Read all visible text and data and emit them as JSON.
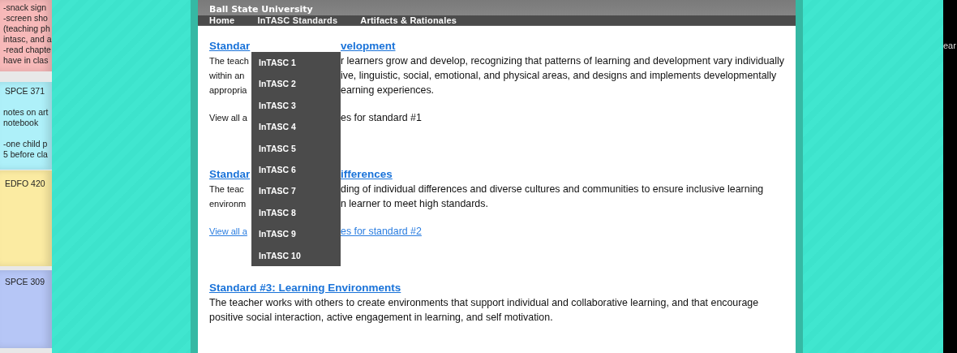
{
  "sticky_notes": [
    {
      "color": "#f7b9b9",
      "paragraphs": [
        [
          "-snack sign",
          "-screen sho",
          "(teaching ph",
          "intasc, and a",
          "-read chapte",
          "have in clas"
        ]
      ]
    },
    {
      "color": "#aef0f9",
      "title": "SPCE 371",
      "paragraphs": [
        [
          "notes on art",
          "notebook"
        ],
        [
          "-one child p",
          "5 before cla"
        ]
      ]
    },
    {
      "color": "#fbeba2",
      "title": "EDFO 420"
    },
    {
      "color": "#b6c6f6",
      "title": "SPCE 309"
    }
  ],
  "site": {
    "header_title": "Ball State University",
    "nav": [
      {
        "label": "Home"
      },
      {
        "label": "InTASC Standards",
        "expanded": true,
        "menu": [
          "InTASC 1",
          "InTASC 2",
          "InTASC 3",
          "InTASC 4",
          "InTASC 5",
          "InTASC 6",
          "InTASC 7",
          "InTASC 8",
          "InTASC 9",
          "InTASC 10"
        ]
      },
      {
        "label": "Artifacts & Rationales"
      }
    ],
    "sections": [
      {
        "title": [
          "Standar",
          "velopment"
        ],
        "text": [
          [
            "The teach",
            "r learners grow and develop, recognizing that patterns of learning and development vary individually"
          ],
          [
            "within an",
            "ive, linguistic, social, emotional, and physical areas, and designs and implements developmentally"
          ],
          [
            "appropria",
            "earning experiences."
          ]
        ],
        "view": {
          "link": false,
          "parts": [
            "View all a",
            "es for standard #1"
          ]
        }
      },
      {
        "title": [
          "Standar",
          "ifferences"
        ],
        "text": [
          [
            "The teac",
            "ding of individual differences and diverse cultures and communities to ensure inclusive learning"
          ],
          [
            "environm",
            "n learner to meet high standards."
          ]
        ],
        "view": {
          "link": true,
          "parts": [
            "View all a",
            "es for standard #2"
          ]
        }
      },
      {
        "title": [
          "Standard #3: Learning Environments"
        ],
        "text": [
          [
            "The teacher works with others to create environments that support individual and collaborative learning, and that encourage"
          ],
          [
            "positive social interaction, active engagement in learning, and self motivation."
          ]
        ]
      }
    ]
  },
  "right_edge_text": "ear"
}
